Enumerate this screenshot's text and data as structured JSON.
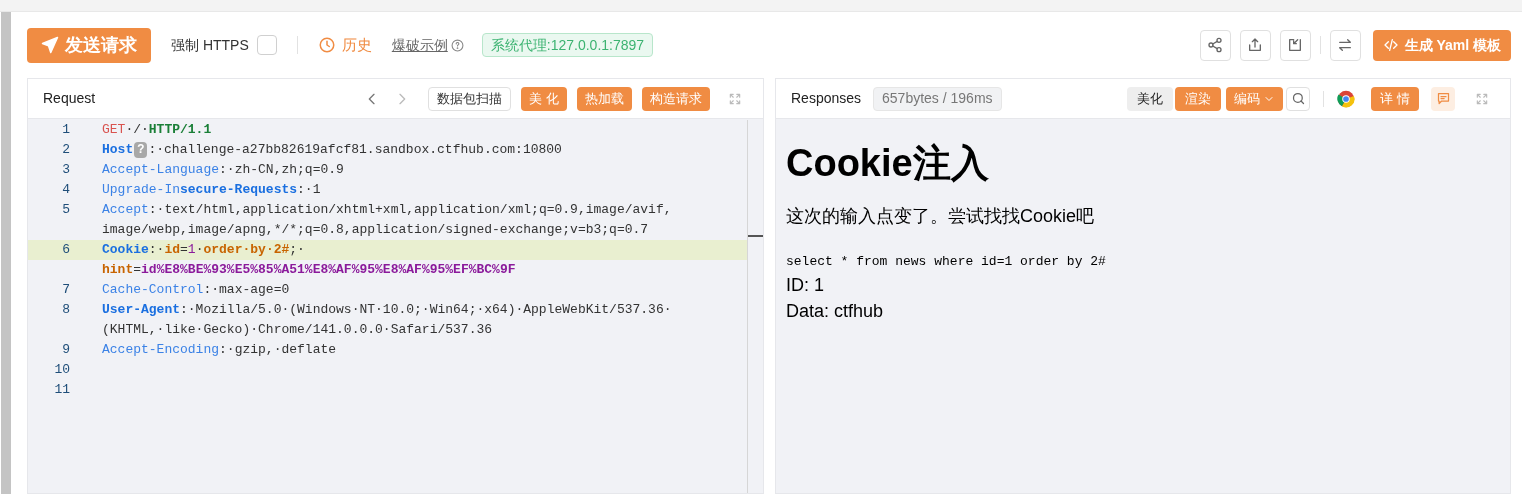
{
  "toolbar": {
    "send_button": "发送请求",
    "force_https": {
      "label": "强制 HTTPS",
      "checked": false
    },
    "history": "历史",
    "brute_example": "爆破示例",
    "proxy": "系统代理:127.0.0.1:7897",
    "yaml_button": "生成 Yaml 模板"
  },
  "request": {
    "title": "Request",
    "buttons": [
      {
        "label": "数据包扫描",
        "kind": "plain"
      },
      {
        "label": "美 化",
        "kind": "accent"
      },
      {
        "label": "热加载",
        "kind": "accent"
      },
      {
        "label": "构造请求",
        "kind": "accent"
      }
    ],
    "rows": [
      {
        "number": "1",
        "highlighted": false,
        "tokens": [
          {
            "kind": "method",
            "text": "GET"
          },
          {
            "kind": "text",
            "text": "·/·"
          },
          {
            "kind": "protocol",
            "text": "HTTP/1.1"
          }
        ]
      },
      {
        "number": "2",
        "highlighted": false,
        "tokens": [
          {
            "kind": "key_strong",
            "text": "Host"
          },
          {
            "kind": "badge",
            "text": "?"
          },
          {
            "kind": "text",
            "text": ":·challenge-a27bb82619afcf81.sandbox.ctfhub.com:10800"
          }
        ]
      },
      {
        "number": "3",
        "highlighted": false,
        "tokens": [
          {
            "kind": "key",
            "text": "Accept-Language"
          },
          {
            "kind": "text",
            "text": ":·zh-CN,zh;q=0.9"
          }
        ]
      },
      {
        "number": "4",
        "highlighted": false,
        "tokens": [
          {
            "kind": "key",
            "text": "Upgrade-In"
          },
          {
            "kind": "key_strong",
            "text": "secure-Requests"
          },
          {
            "kind": "text",
            "text": ":·1"
          }
        ]
      },
      {
        "number": "5",
        "highlighted": false,
        "tokens": [
          {
            "kind": "key",
            "text": "Accept"
          },
          {
            "kind": "text",
            "text": ":·text/html,application/xhtml+xml,application/xml;q=0.9,image/avif,"
          }
        ]
      },
      {
        "highlighted": false,
        "tokens": [
          {
            "kind": "text",
            "text": "image/webp,image/apng,*/*;q=0.8,application/signed-exchange;v=b3;q=0.7"
          }
        ]
      },
      {
        "number": "6",
        "highlighted": true,
        "tokens": [
          {
            "kind": "key_strong",
            "text": "Cookie"
          },
          {
            "kind": "text",
            "text": ":·"
          },
          {
            "kind": "kw",
            "text": "id"
          },
          {
            "kind": "text",
            "text": "="
          },
          {
            "kind": "num",
            "text": "1"
          },
          {
            "kind": "text",
            "text": "·"
          },
          {
            "kind": "kw",
            "text": "order·by·2#"
          },
          {
            "kind": "text",
            "text": ";·"
          }
        ]
      },
      {
        "highlighted": false,
        "tokens": [
          {
            "kind": "kw",
            "text": "hint"
          },
          {
            "kind": "text",
            "text": "="
          },
          {
            "kind": "param",
            "text": "id%E8%BE%93%E5%85%A51%E8%AF%95%E8%AF%95%EF%BC%9F"
          }
        ]
      },
      {
        "number": "7",
        "highlighted": false,
        "tokens": [
          {
            "kind": "key",
            "text": "Cache-Control"
          },
          {
            "kind": "text",
            "text": ":·max-age=0"
          }
        ]
      },
      {
        "number": "8",
        "highlighted": false,
        "tokens": [
          {
            "kind": "key_strong",
            "text": "User-Agent"
          },
          {
            "kind": "text",
            "text": ":·Mozilla/5.0·(Windows·NT·10.0;·Win64;·x64)·AppleWebKit/537.36·"
          }
        ]
      },
      {
        "highlighted": false,
        "tokens": [
          {
            "kind": "text",
            "text": "(KHTML,·like·Gecko)·Chrome/141.0.0.0·Safari/537.36"
          }
        ]
      },
      {
        "number": "9",
        "highlighted": false,
        "tokens": [
          {
            "kind": "key",
            "text": "Accept-Encoding"
          },
          {
            "kind": "text",
            "text": ":·gzip,·deflate"
          }
        ]
      },
      {
        "number": "10",
        "highlighted": false,
        "tokens": []
      },
      {
        "number": "11",
        "highlighted": false,
        "tokens": []
      }
    ]
  },
  "response": {
    "title": "Responses",
    "stats": "657bytes / 196ms",
    "tabs": [
      {
        "label": "美化",
        "selected": false
      },
      {
        "label": "渲染",
        "selected": true
      }
    ],
    "encoding": "编码",
    "details": "详 情",
    "page": {
      "heading": "Cookie注入",
      "text": "这次的输入点变了。尝试找找Cookie吧",
      "query": "select * from news where id=1 order by 2#",
      "lines": [
        "ID: 1",
        "Data: ctfhub"
      ]
    }
  }
}
